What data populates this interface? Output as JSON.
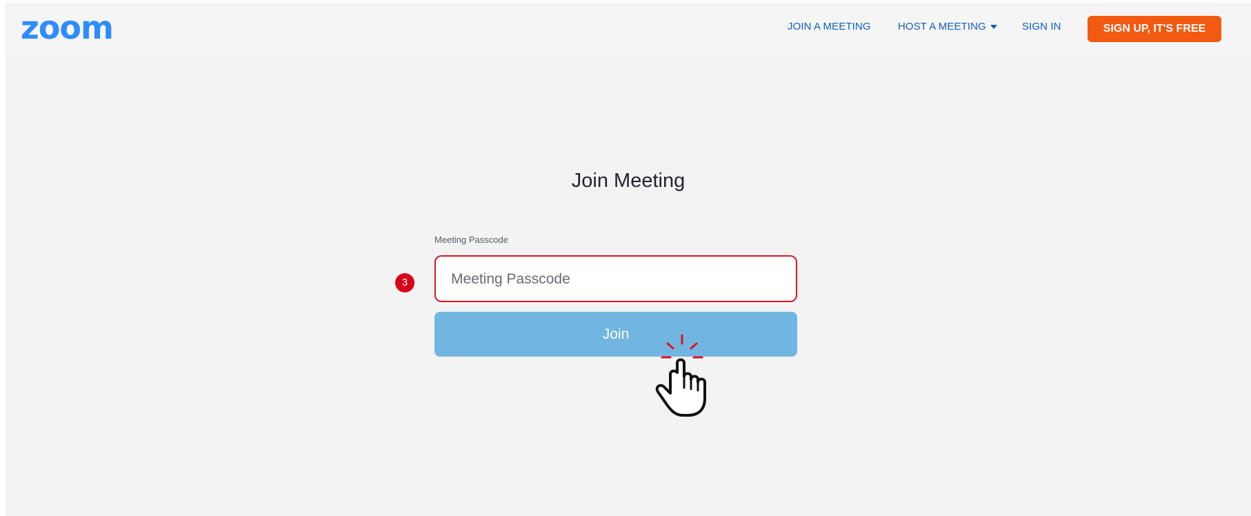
{
  "header": {
    "logo_text": "zoom",
    "nav": {
      "join": "JOIN A MEETING",
      "host": "HOST A MEETING",
      "signin": "SIGN IN"
    },
    "signup_label": "SIGN UP, IT'S FREE"
  },
  "main": {
    "title": "Join Meeting",
    "passcode_label": "Meeting Passcode",
    "passcode_placeholder": "Meeting Passcode",
    "passcode_value": "",
    "step_number": "3",
    "join_label": "Join"
  },
  "colors": {
    "brand_blue": "#2d8cff",
    "nav_blue": "#0e5fc0",
    "signup_orange": "#f15a10",
    "join_button": "#71b6e1",
    "highlight_red": "#dc1420"
  },
  "icons": {
    "cursor": "pointer-hand-icon",
    "caret": "caret-down-icon"
  }
}
